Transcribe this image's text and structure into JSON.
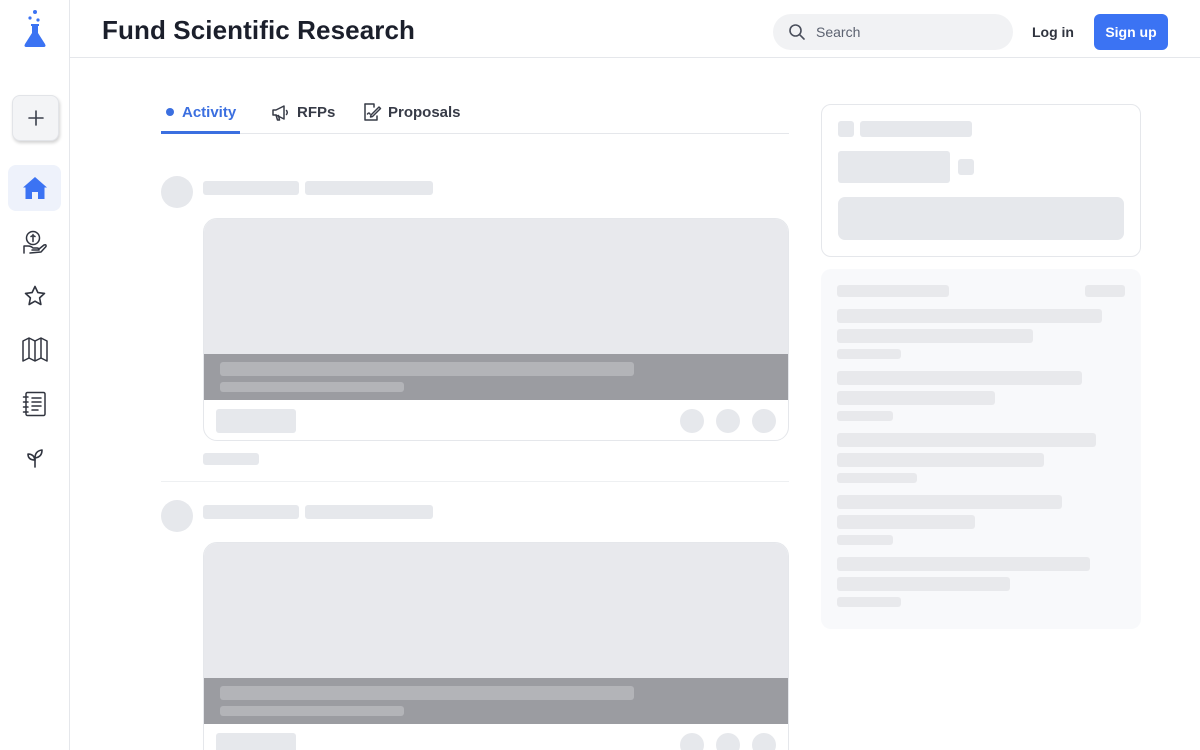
{
  "app": {
    "page_title": "Fund Scientific Research"
  },
  "sidebar": {
    "items": [
      {
        "name": "home",
        "active": true
      },
      {
        "name": "fund"
      },
      {
        "name": "starred"
      },
      {
        "name": "learn"
      },
      {
        "name": "notebook"
      },
      {
        "name": "grow"
      }
    ]
  },
  "header": {
    "search_placeholder": "Search",
    "login_label": "Log in",
    "signup_label": "Sign up"
  },
  "tabs": [
    {
      "label": "Activity",
      "icon": "dot-icon",
      "active": true
    },
    {
      "label": "RFPs",
      "icon": "megaphone-icon"
    },
    {
      "label": "Proposals",
      "icon": "proposal-icon"
    }
  ],
  "colors": {
    "accent": "#3b73f3",
    "tab_active": "#3b6fe0",
    "skeleton": "#e6e8ec",
    "card_band": "#9b9ca1"
  }
}
